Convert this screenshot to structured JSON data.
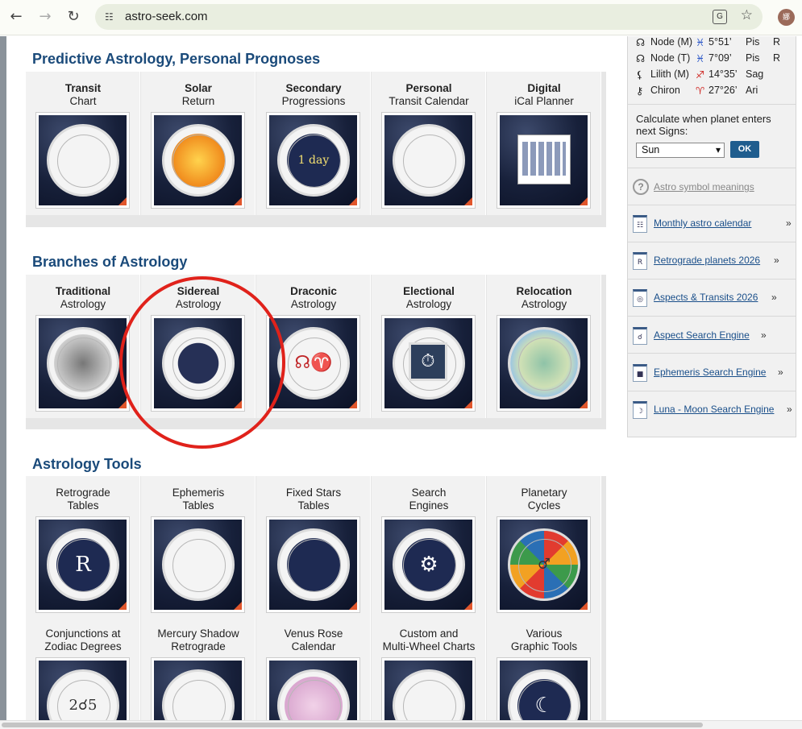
{
  "browser": {
    "url": "astro-seek.com",
    "back_icon": "←",
    "forward_icon": "→",
    "reload_icon": "↻",
    "site_info_icon": "☷",
    "translate_icon": "G",
    "star_icon": "☆",
    "avatar_text": "娜"
  },
  "sections": [
    {
      "title": "Predictive Astrology, Personal Prognoses",
      "items": [
        {
          "line1": "Transit",
          "line2": "Chart",
          "bold": true
        },
        {
          "line1": "Solar",
          "line2": "Return",
          "bold": true
        },
        {
          "line1": "Secondary",
          "line2": "Progressions",
          "bold": true
        },
        {
          "line1": "Personal",
          "line2": "Transit Calendar",
          "bold": true
        },
        {
          "line1": "Digital",
          "line2": "iCal Planner",
          "bold": true
        }
      ]
    },
    {
      "title": "Branches of Astrology",
      "items": [
        {
          "line1": "Traditional",
          "line2": "Astrology",
          "bold": true
        },
        {
          "line1": "Sidereal",
          "line2": "Astrology",
          "bold": true
        },
        {
          "line1": "Draconic",
          "line2": "Astrology",
          "bold": true
        },
        {
          "line1": "Electional",
          "line2": "Astrology",
          "bold": true
        },
        {
          "line1": "Relocation",
          "line2": "Astrology",
          "bold": true
        }
      ]
    },
    {
      "title": "Astrology Tools",
      "items": [
        {
          "line1": "Retrograde",
          "line2": "Tables"
        },
        {
          "line1": "Ephemeris",
          "line2": "Tables"
        },
        {
          "line1": "Fixed Stars",
          "line2": "Tables"
        },
        {
          "line1": "Search",
          "line2": "Engines"
        },
        {
          "line1": "Planetary",
          "line2": "Cycles"
        },
        {
          "line1": "Conjunctions at",
          "line2": "Zodiac Degrees"
        },
        {
          "line1": "Mercury Shadow",
          "line2": "Retrograde"
        },
        {
          "line1": "Venus Rose",
          "line2": "Calendar"
        },
        {
          "line1": "Custom and",
          "line2": "Multi-Wheel Charts"
        },
        {
          "line1": "Various",
          "line2": "Graphic Tools"
        }
      ]
    }
  ],
  "thumb_glyphs": {
    "secondary": "1 day",
    "retrograde": "R",
    "draconic": "☊♈",
    "planetary": "♂",
    "conjunctions": "2☌5",
    "various": "☾"
  },
  "sidebar": {
    "planets": [
      {
        "symbol": "☊",
        "name": "Node (M)",
        "sign_symbol": "♓",
        "degree": "5°51’",
        "sign": "Pis",
        "retro": "R",
        "sign_color": "#2b57c8"
      },
      {
        "symbol": "☊",
        "name": "Node (T)",
        "sign_symbol": "♓",
        "degree": "7°09’",
        "sign": "Pis",
        "retro": "R",
        "sign_color": "#2b57c8"
      },
      {
        "symbol": "⚸",
        "name": "Lilith (M)",
        "sign_symbol": "♐",
        "degree": "14°35’",
        "sign": "Sag",
        "retro": "",
        "sign_color": "#d0312d"
      },
      {
        "symbol": "⚷",
        "name": "Chiron",
        "sign_symbol": "♈",
        "degree": "27°26’",
        "sign": "Ari",
        "retro": "",
        "sign_color": "#d0312d"
      }
    ],
    "calc_label": "Calculate when planet enters next Signs:",
    "select_value": "Sun",
    "ok_label": "OK",
    "help_label": "Astro symbol meanings",
    "links": [
      {
        "icon": "☷",
        "label": "Monthly astro calendar",
        "arrow": "»"
      },
      {
        "icon": "R",
        "label": "Retrograde planets 2026",
        "arrow": "»"
      },
      {
        "icon": "◎",
        "label": "Aspects & Transits 2026",
        "arrow": "»"
      },
      {
        "icon": "☌",
        "label": "Aspect Search Engine",
        "arrow": "»"
      },
      {
        "icon": "■",
        "label": "Ephemeris Search Engine",
        "arrow": "»"
      },
      {
        "icon": "☽",
        "label": "Luna - Moon Search Engine",
        "arrow": "»"
      }
    ]
  }
}
